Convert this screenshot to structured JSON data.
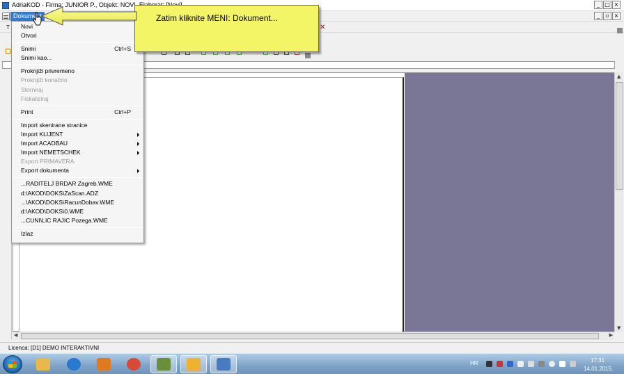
{
  "window": {
    "title": "AdriaKOD - Firma: JUNIOR P.,  Objekt: NOVI,  Elaborat: [Novi]"
  },
  "menubar": {
    "active_menu": "Dokument"
  },
  "toolbar": {
    "left_label": "T"
  },
  "dokument_menu": {
    "groups": [
      [
        {
          "label": "Novi",
          "shortcut": "",
          "submenu": false,
          "enabled": true
        },
        {
          "label": "Otvori",
          "shortcut": "",
          "submenu": false,
          "enabled": true
        }
      ],
      [
        {
          "label": "Snimi",
          "shortcut": "Ctrl+S",
          "submenu": false,
          "enabled": true
        },
        {
          "label": "Snimi kao...",
          "shortcut": "",
          "submenu": false,
          "enabled": true
        }
      ],
      [
        {
          "label": "Proknjiži privremeno",
          "shortcut": "",
          "submenu": false,
          "enabled": true
        },
        {
          "label": "Proknjiži konačno",
          "shortcut": "",
          "submenu": false,
          "enabled": false
        },
        {
          "label": "Storniraj",
          "shortcut": "",
          "submenu": false,
          "enabled": false
        },
        {
          "label": "Fiskaliziraj",
          "shortcut": "",
          "submenu": false,
          "enabled": false
        }
      ],
      [
        {
          "label": "Print",
          "shortcut": "Ctrl+P",
          "submenu": false,
          "enabled": true
        }
      ],
      [
        {
          "label": "Import skenirane stranice",
          "shortcut": "",
          "submenu": false,
          "enabled": true
        },
        {
          "label": "Import KLIJENT",
          "shortcut": "",
          "submenu": true,
          "enabled": true
        },
        {
          "label": "Import ACADBAU",
          "shortcut": "",
          "submenu": true,
          "enabled": true
        },
        {
          "label": "Import NEMETSCHEK",
          "shortcut": "",
          "submenu": true,
          "enabled": true
        },
        {
          "label": "Export PRIMAVERA",
          "shortcut": "",
          "submenu": false,
          "enabled": false
        },
        {
          "label": "Export dokumenta",
          "shortcut": "",
          "submenu": true,
          "enabled": true
        }
      ],
      [
        {
          "label": "...RADITELJ BRDAR Zagreb.WME",
          "shortcut": "",
          "submenu": false,
          "enabled": true
        },
        {
          "label": "d:\\AKOD\\DOKS\\ZaScan.ADZ",
          "shortcut": "",
          "submenu": false,
          "enabled": true
        },
        {
          "label": "...\\AKOD\\DOKS\\RacunDobav.WME",
          "shortcut": "",
          "submenu": false,
          "enabled": true
        },
        {
          "label": "d:\\AKOD\\DOKS\\0.WME",
          "shortcut": "",
          "submenu": false,
          "enabled": true
        },
        {
          "label": "...CUNI\\LIC RAJIC Pozega.WME",
          "shortcut": "",
          "submenu": false,
          "enabled": true
        }
      ],
      [
        {
          "label": "Izlaz",
          "shortcut": "",
          "submenu": false,
          "enabled": true
        }
      ]
    ]
  },
  "callout": {
    "text": "Zatim kliknite MENI: Dokument..."
  },
  "statusbar": {
    "text": "Licenca:  [D1] DEMO INTERAKTIVNI"
  },
  "taskbar": {
    "apps": [
      {
        "name": "explorer",
        "color": "#e8b84a"
      },
      {
        "name": "internet-explorer",
        "color": "#2a78d0"
      },
      {
        "name": "media-player",
        "color": "#e07a20"
      },
      {
        "name": "chrome",
        "color": "#d84a38"
      },
      {
        "name": "adriakod",
        "color": "#6b8e3a"
      },
      {
        "name": "tool",
        "color": "#f0b030"
      },
      {
        "name": "network",
        "color": "#4a7bbf"
      }
    ],
    "tray": {
      "language": "HR",
      "time": "17:31",
      "date": "14.01.2015."
    }
  },
  "colors": {
    "menu_highlight": "#3379d6",
    "callout_bg": "#f4f467",
    "workspace_gray": "#7a7696"
  }
}
